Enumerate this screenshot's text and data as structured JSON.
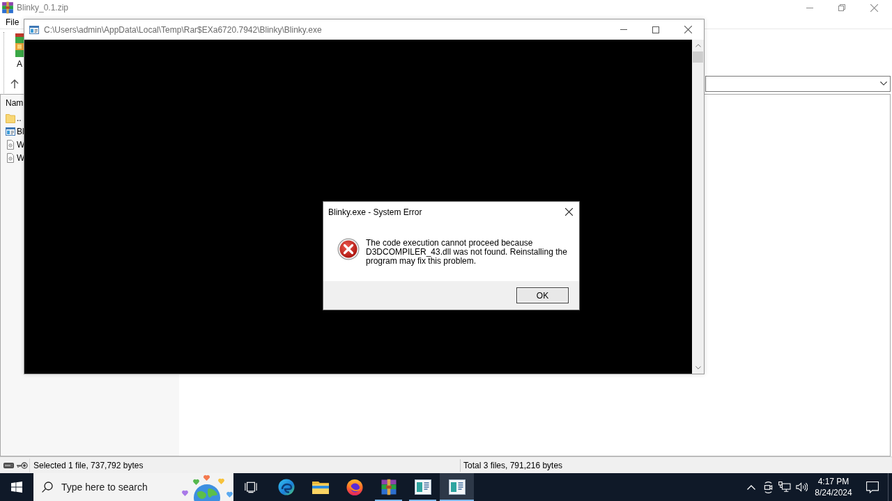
{
  "archive_window": {
    "title": "Blinky_0.1.zip",
    "menu": [
      "File"
    ],
    "toolbar": [
      {
        "label": "A"
      }
    ],
    "file_list": {
      "columns": [
        "Nam"
      ],
      "rows": [
        {
          "name": "..",
          "kind": "folder"
        },
        {
          "name": "Bl",
          "kind": "program"
        },
        {
          "name": "W",
          "kind": "document"
        },
        {
          "name": "W",
          "kind": "document"
        }
      ]
    },
    "status_bar": {
      "selection": "Selected 1 file, 737,792 bytes",
      "total": "Total 3 files, 791,216 bytes"
    }
  },
  "console_window": {
    "title": "C:\\Users\\admin\\AppData\\Local\\Temp\\Rar$EXa6720.7942\\Blinky\\Blinky.exe"
  },
  "error_dialog": {
    "title": "Blinky.exe - System Error",
    "message": "The code execution cannot proceed because D3DCOMPILER_43.dll was not found. Reinstalling the program may fix this problem.",
    "buttons": [
      "OK"
    ]
  },
  "taskbar": {
    "search": {
      "placeholder": "Type here to search"
    },
    "apps": [
      {
        "kind": "browser",
        "open": false,
        "selected": false
      },
      {
        "kind": "folder",
        "open": false,
        "selected": false
      },
      {
        "kind": "fox",
        "open": false,
        "selected": false
      },
      {
        "kind": "archiver",
        "open": true,
        "selected": false
      },
      {
        "kind": "app",
        "open": true,
        "selected": false
      },
      {
        "kind": "app",
        "open": true,
        "selected": true
      }
    ],
    "clock": {
      "time": "4:17 PM",
      "date": "8/24/2024"
    }
  }
}
